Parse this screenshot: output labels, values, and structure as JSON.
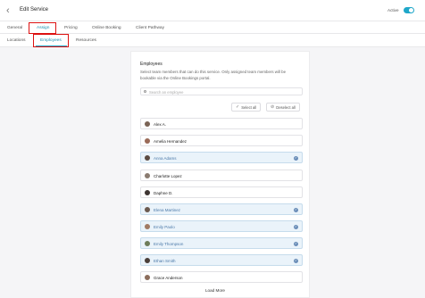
{
  "header": {
    "back_icon": "chevron-left-icon",
    "title": "Edit Service",
    "active_label": "Active",
    "active": true,
    "accent": "#1fa7c9"
  },
  "tabs": [
    "General",
    "Assign",
    "Pricing",
    "Online Booking",
    "Client Pathway"
  ],
  "active_tab": "Assign",
  "subtabs": [
    "Locations",
    "Employees",
    "Resources"
  ],
  "active_subtab": "Employees",
  "panel": {
    "heading": "Employees",
    "description": "Select team members that can do this service. Only assigned team members will be bookable via the Online Bookings portal.",
    "search_placeholder": "Search an employee",
    "select_all": "Select all",
    "deselect_all": "Deselect all",
    "load_more": "Load More"
  },
  "employees": [
    {
      "name": "Alex A.",
      "selected": false
    },
    {
      "name": "Amelia Hernandez",
      "selected": false
    },
    {
      "name": "Anna Adams",
      "selected": true
    },
    {
      "name": "Charlotte Lopez",
      "selected": false
    },
    {
      "name": "Daphne D.",
      "selected": false
    },
    {
      "name": "Elena Martinez",
      "selected": true
    },
    {
      "name": "Emily Paolo",
      "selected": true
    },
    {
      "name": "Emily Thompson",
      "selected": true
    },
    {
      "name": "Ethan Smith",
      "selected": true
    },
    {
      "name": "Grace Anderson",
      "selected": false
    }
  ]
}
